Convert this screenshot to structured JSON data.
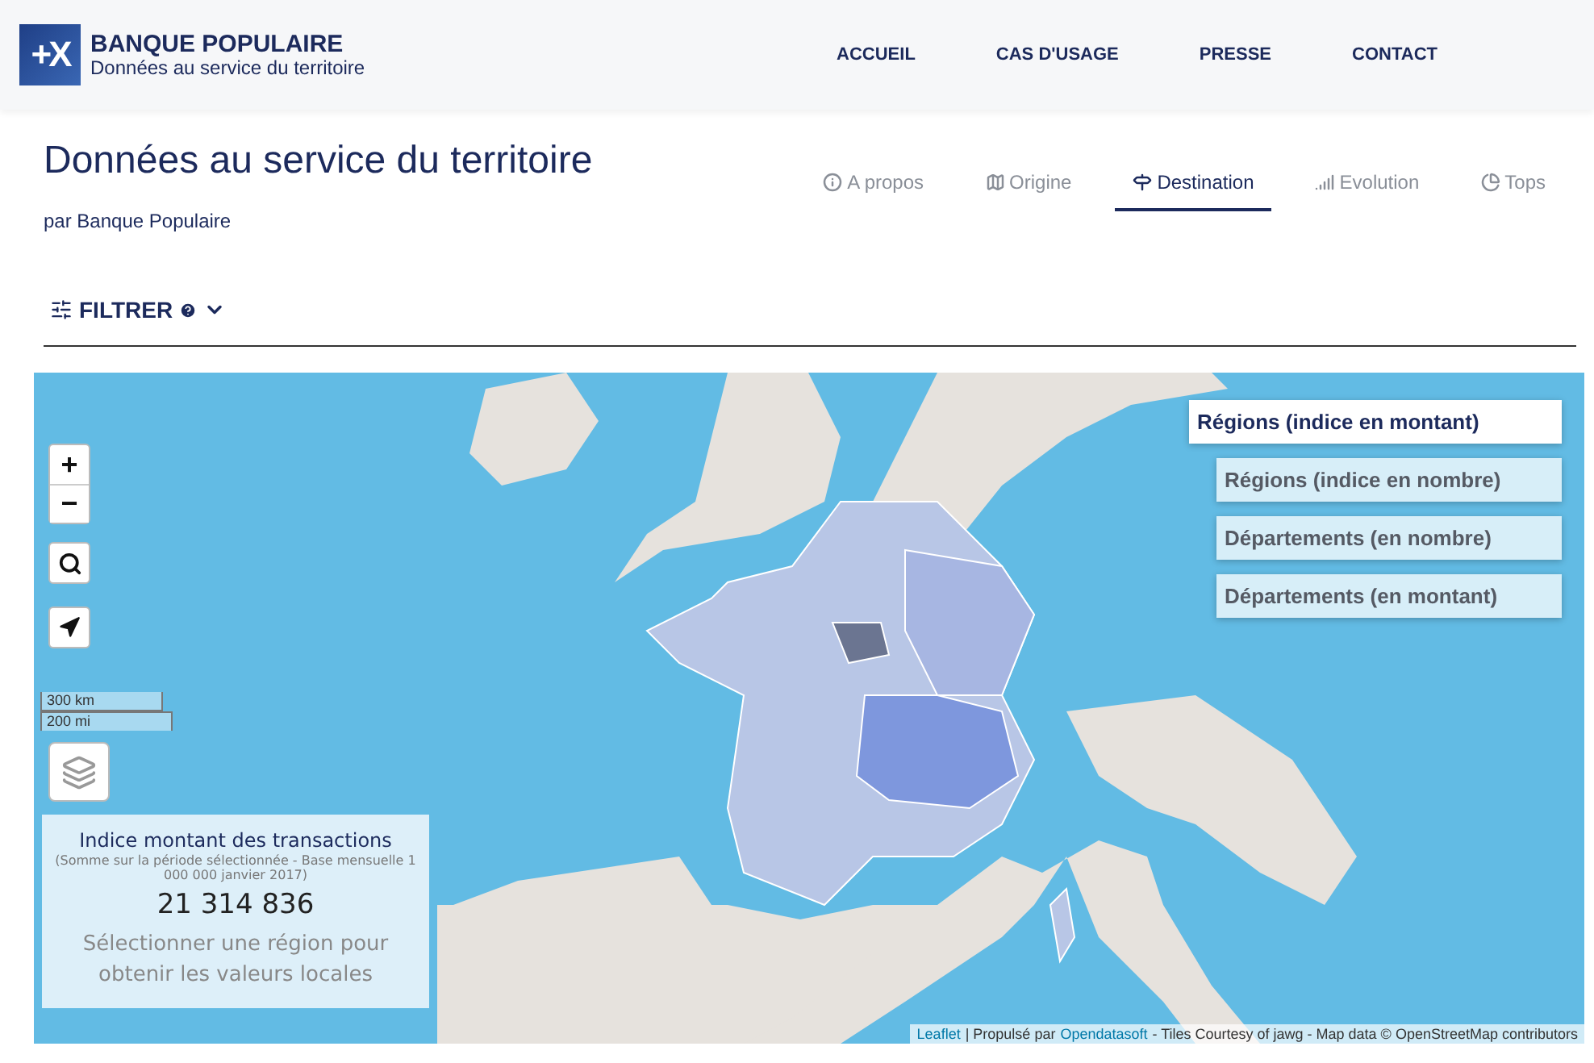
{
  "header": {
    "logo": {
      "mark": "+X",
      "name": "BANQUE POPULAIRE",
      "tagline": "Données au service du territoire"
    },
    "nav": [
      {
        "label": "ACCUEIL"
      },
      {
        "label": "CAS D'USAGE"
      },
      {
        "label": "PRESSE"
      },
      {
        "label": "CONTACT"
      }
    ]
  },
  "page": {
    "title": "Données au service du territoire",
    "subtitle": "par Banque Populaire",
    "tabs": [
      {
        "label": "A propos",
        "selected": false
      },
      {
        "label": "Origine",
        "selected": false
      },
      {
        "label": "Destination",
        "selected": true
      },
      {
        "label": "Evolution",
        "selected": false
      },
      {
        "label": "Tops",
        "selected": false
      }
    ]
  },
  "filter": {
    "label": "FILTRER",
    "expanded": false
  },
  "map": {
    "zoom_in": "+",
    "zoom_out": "−",
    "scale": [
      "300 km",
      "200 mi"
    ],
    "layers": [
      {
        "label": "Régions (indice en montant)",
        "selected": true
      },
      {
        "label": "Régions (indice en nombre)",
        "selected": false
      },
      {
        "label": "Départements (en nombre)",
        "selected": false
      },
      {
        "label": "Départements (en montant)",
        "selected": false
      }
    ],
    "info": {
      "title": "Indice montant des transactions",
      "note": "(Somme sur la période sélectionnée - Base mensuelle 1 000 000 janvier 2017)",
      "value": "21 314 836",
      "hint": "Sélectionner une région pour obtenir les valeurs locales"
    },
    "attribution": {
      "leaflet": "Leaflet",
      "sep": "| Propulsé par",
      "provider": "Opendatasoft",
      "rest": "- Tiles Courtesy of jawg - Map data © OpenStreetMap contributors"
    }
  }
}
